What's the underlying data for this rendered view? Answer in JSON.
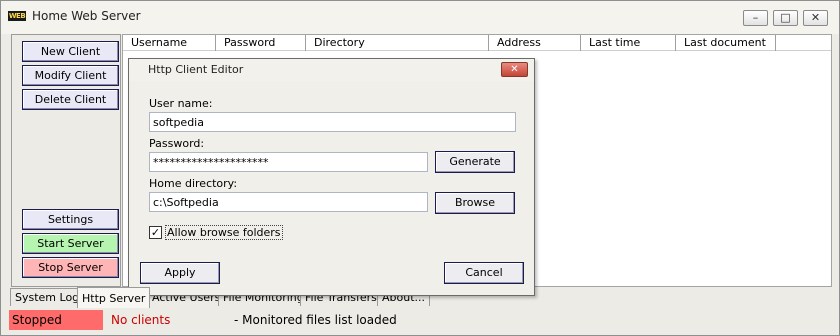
{
  "window": {
    "title": "Home Web Server",
    "logo_text": "WEB",
    "minimize_glyph": "–",
    "maximize_glyph": "□",
    "close_glyph": "✕"
  },
  "sidebar": {
    "new_client": "New Client",
    "modify_client": "Modify Client",
    "delete_client": "Delete Client",
    "settings": "Settings",
    "start_server": "Start Server",
    "stop_server": "Stop Server"
  },
  "table": {
    "columns": [
      "Username",
      "Password",
      "Directory",
      "Address",
      "Last time",
      "Last document"
    ]
  },
  "tabs": [
    "System Log",
    "Http Server",
    "Active Users",
    "File Monitoring",
    "File Transfers",
    "About..."
  ],
  "status": {
    "server_state": "Stopped",
    "clients": "No clients",
    "message": "- Monitored files list loaded"
  },
  "dialog": {
    "title": "Http Client Editor",
    "close_glyph": "✕",
    "username_label": "User name:",
    "username_value": "softpedia",
    "password_label": "Password:",
    "password_value": "*********************",
    "generate_button": "Generate",
    "homedir_label": "Home directory:",
    "homedir_value": "c:\\Softpedia",
    "browse_button": "Browse",
    "allow_browse_label": "Allow browse folders",
    "allow_browse_checked": true,
    "checkmark": "✓",
    "apply_button": "Apply",
    "cancel_button": "Cancel"
  },
  "colors": {
    "start_server": "#b6f5b0",
    "stop_server": "#ffb5b5",
    "status_stopped": "#ff6b6b",
    "status_clients": "#cc0000"
  }
}
